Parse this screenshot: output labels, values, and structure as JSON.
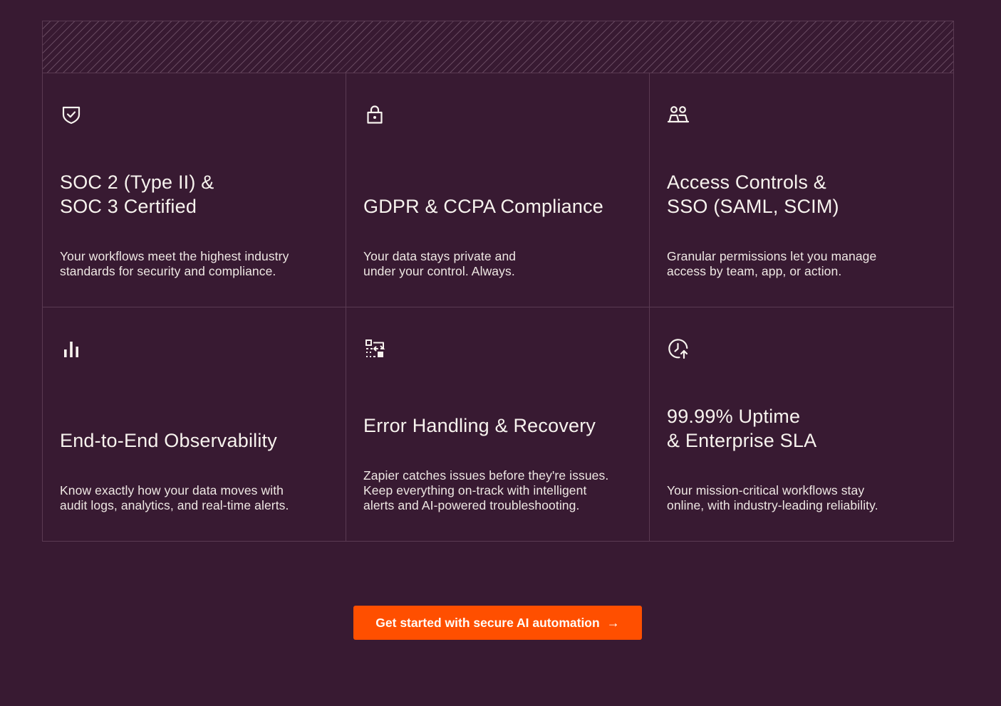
{
  "features": [
    {
      "icon": "shield-check-icon",
      "title": "SOC 2 (Type II) &\nSOC 3 Certified",
      "description": "Your workflows meet the highest industry\nstandards for security and compliance."
    },
    {
      "icon": "lock-icon",
      "title": "GDPR & CCPA Compliance",
      "description": "Your data stays private and\nunder your control. Always."
    },
    {
      "icon": "users-icon",
      "title": "Access Controls &\nSSO (SAML, SCIM)",
      "description": "Granular permissions let you manage\naccess by team, app, or action."
    },
    {
      "icon": "bar-chart-icon",
      "title": "End-to-End Observability",
      "description": "Know exactly how your data moves with\naudit logs, analytics, and real-time alerts."
    },
    {
      "icon": "flow-recovery-icon",
      "title": "Error Handling & Recovery",
      "description": "Zapier catches issues before they're issues.\nKeep everything on-track with intelligent\nalerts and AI-powered troubleshooting."
    },
    {
      "icon": "clock-up-icon",
      "title": "99.99% Uptime\n& Enterprise SLA",
      "description": "Your mission-critical workflows stay\nonline, with industry-leading reliability."
    }
  ],
  "cta": {
    "label": "Get started with secure AI automation",
    "arrow": "→",
    "color": "#ff4f00"
  },
  "colors": {
    "background": "#381a32",
    "border": "#5a3a52",
    "text": "#f7f3ee"
  }
}
